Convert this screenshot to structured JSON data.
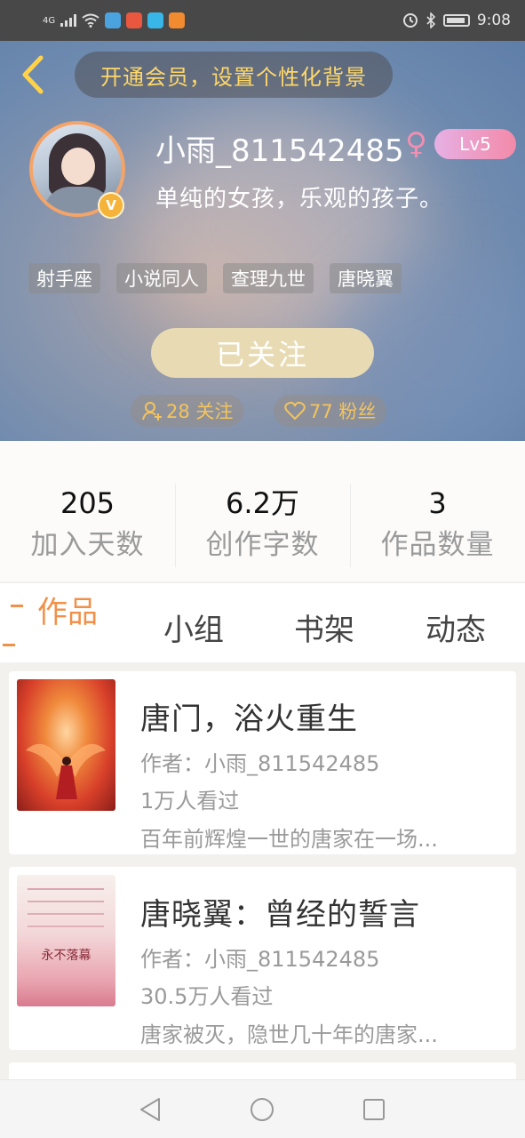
{
  "status_bar": {
    "network": "4G",
    "time": "9:08",
    "app_icons": [
      {
        "name": "app-icon-blue",
        "color": "#4aa3df"
      },
      {
        "name": "app-icon-red",
        "color": "#e9573f"
      },
      {
        "name": "app-icon-cyan",
        "color": "#38b6e8"
      },
      {
        "name": "app-icon-orange",
        "color": "#f28b30"
      }
    ]
  },
  "header": {
    "vip_banner": "开通会员，设置个性化背景",
    "username": "小雨_811542485",
    "gender_symbol": "♀",
    "level": "Lv5",
    "verified_badge": "V",
    "bio": "单纯的女孩，乐观的孩子。",
    "tags": [
      "射手座",
      "小说同人",
      "查理九世",
      "唐晓翼"
    ],
    "follow_button": "已关注",
    "following_count": "28 关注",
    "fans_count": "77 粉丝"
  },
  "stats": [
    {
      "value": "205",
      "label": "加入天数"
    },
    {
      "value": "6.2万",
      "label": "创作字数"
    },
    {
      "value": "3",
      "label": "作品数量"
    }
  ],
  "tabs": [
    {
      "label": "作品",
      "active": true
    },
    {
      "label": "小组",
      "active": false
    },
    {
      "label": "书架",
      "active": false
    },
    {
      "label": "动态",
      "active": false
    }
  ],
  "works": [
    {
      "title": "唐门，浴火重生",
      "author": "作者：小雨_811542485",
      "views": "1万人看过",
      "description": "百年前辉煌一世的唐家在一场..."
    },
    {
      "title": "唐晓翼：曾经的誓言",
      "author": "作者：小雨_811542485",
      "views": "30.5万人看过",
      "description": "唐家被灭，隐世几十年的唐家...",
      "cover_text": "永不落幕"
    }
  ],
  "colors": {
    "accent": "#f19149",
    "vip_text": "#ffd86a",
    "follow_button": "#e8dbb4",
    "count_text": "#f4c45c"
  }
}
